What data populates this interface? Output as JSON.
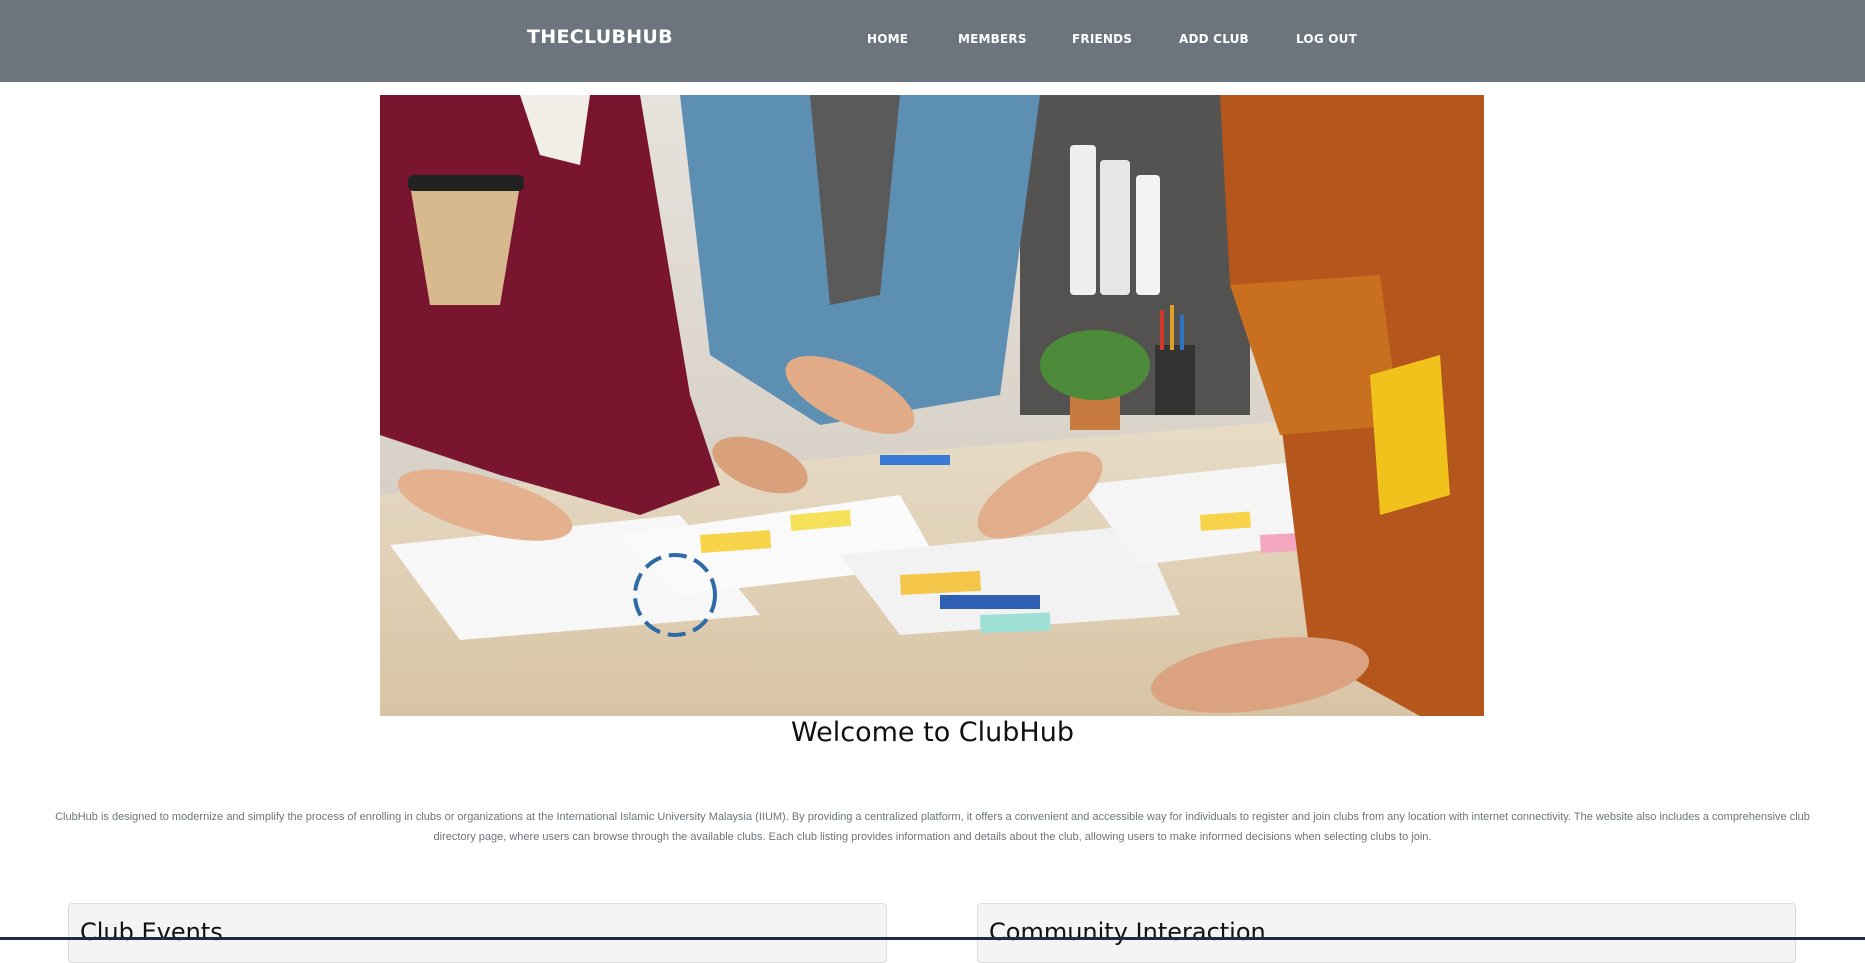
{
  "navbar": {
    "brand": "THECLUBHUB",
    "links": [
      "HOME",
      "MEMBERS",
      "FRIENDS",
      "ADD CLUB",
      "LOG OUT"
    ],
    "background": "#6c757d"
  },
  "hero": {
    "alt": "Team collaborating over sticky notes and design sketches on a table"
  },
  "welcome": {
    "title": "Welcome to ClubHub"
  },
  "intro": {
    "text": "ClubHub is designed to modernize and simplify the process of enrolling in clubs or organizations at the International Islamic University Malaysia (IIUM). By providing a centralized platform, it offers a convenient and accessible way for individuals to register and join clubs from any location with internet connectivity. The website also includes a comprehensive club directory page, where users can browse through the available clubs. Each club listing provides information and details about the club, allowing users to make informed decisions when selecting clubs to join."
  },
  "cards": {
    "events_title": "Club Events",
    "community_title": "Community Interaction"
  }
}
